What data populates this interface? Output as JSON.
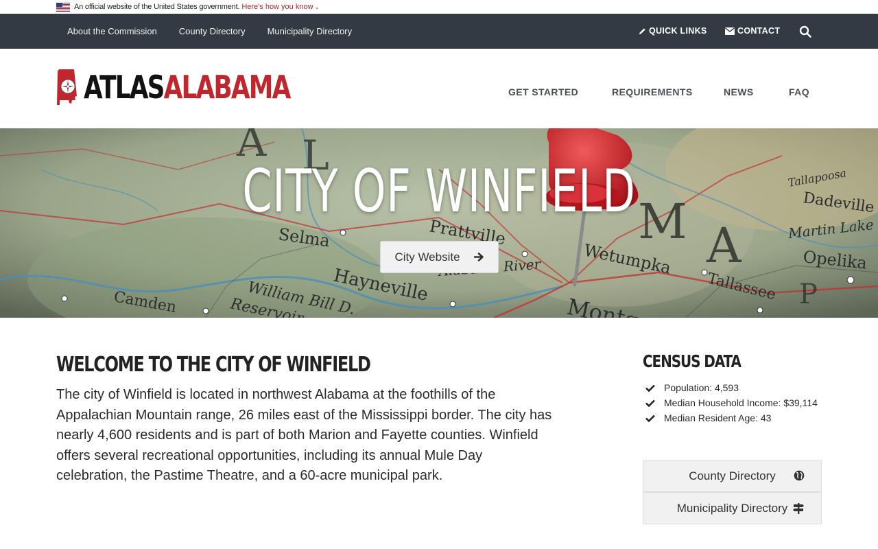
{
  "gov_banner": {
    "text": "An official website of the United States government.",
    "link": "Here's how you know"
  },
  "utility_nav": [
    "About the Commission",
    "County Directory",
    "Municipality Directory"
  ],
  "right_nav": {
    "quick_links": "QUICK LINKS",
    "contact": "CONTACT"
  },
  "logo": {
    "part1": "ATLAS",
    "part2": "ALABAMA"
  },
  "main_nav": [
    "GET STARTED",
    "REQUIREMENTS",
    "NEWS",
    "FAQ"
  ],
  "hero": {
    "title": "CITY OF WINFIELD",
    "button": "City Website",
    "map_labels": [
      "Selma",
      "Prattville",
      "Wetumpka",
      "Tallassee",
      "Opelika",
      "Hayneville",
      "Alabama River",
      "William Bill D.",
      "Reservoir",
      "Camden",
      "Dadeville",
      "Tallapoosa",
      "Martin Lake",
      "Montgomery"
    ]
  },
  "welcome": {
    "heading": "WELCOME TO THE CITY OF WINFIELD",
    "body": "The city of Winfield is located in northwest Alabama at the foothills of the Appalachian Mountain range, 26 miles east of the Mississippi border. The city has nearly 4,600 residents and is part of both Marion and Fayette counties. Winfield offers several recreational opportunities, including its annual Mule Day celebration, the Pastime Theatre, and a 60-acre municipal park."
  },
  "census": {
    "heading": "CENSUS DATA",
    "items": [
      "Population: 4,593",
      "Median Household Income: $39,114",
      "Median Resident Age: 43"
    ]
  },
  "directory_buttons": {
    "county": "County Directory",
    "municipality": "Municipality Directory"
  },
  "colors": {
    "topbar": "#343a44",
    "brand_red": "#c0262d",
    "button_bg": "#f1f1f1"
  }
}
